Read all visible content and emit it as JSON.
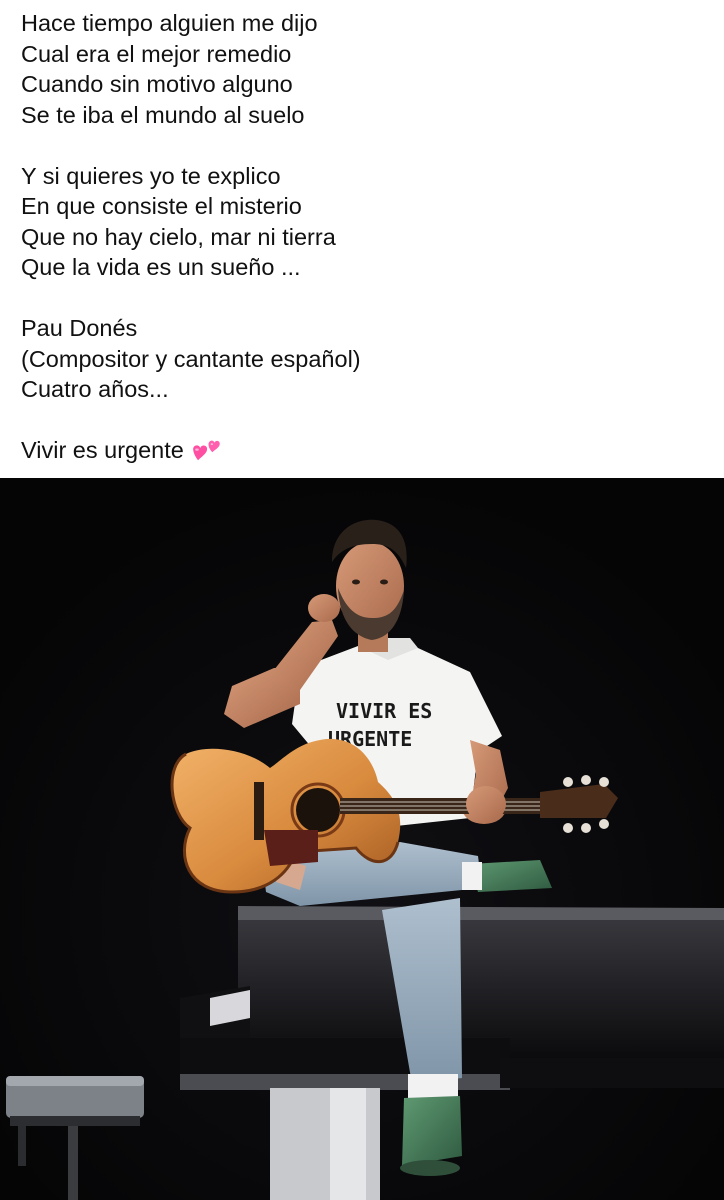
{
  "post": {
    "stanzas": [
      {
        "lines": [
          "Hace tiempo alguien me dijo",
          "Cual era el mejor remedio",
          "Cuando sin motivo alguno",
          "Se te iba el mundo al suelo"
        ]
      },
      {
        "lines": [
          "Y si quieres yo te explico",
          "En que consiste el misterio",
          "Que no hay cielo, mar ni tierra",
          "Que la vida es un sueño ..."
        ]
      },
      {
        "lines": [
          "Pau Donés",
          "(Compositor y cantante español)",
          "Cuatro años..."
        ]
      },
      {
        "lines": [
          "Vivir es urgente"
        ],
        "trailing_emoji": "two-hearts-icon"
      }
    ]
  },
  "photo": {
    "shirt_text_line1": "VIVIR ES",
    "shirt_text_line2": "URGENTE"
  }
}
